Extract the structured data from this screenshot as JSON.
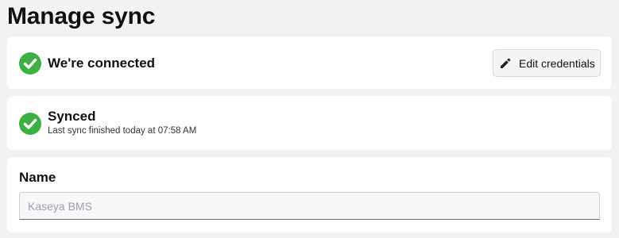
{
  "page": {
    "title": "Manage sync"
  },
  "connection": {
    "status_label": "We're connected",
    "edit_button_label": "Edit credentials",
    "status_icon": "check-circle-icon",
    "edit_icon": "pencil-icon"
  },
  "sync": {
    "status_label": "Synced",
    "detail": "Last sync finished today at 07:58 AM",
    "status_icon": "check-circle-icon"
  },
  "name_field": {
    "label": "Name",
    "placeholder": "Kaseya BMS",
    "value": ""
  },
  "colors": {
    "success": "#3cb043",
    "background": "#f2f2f5",
    "card": "#ffffff"
  }
}
